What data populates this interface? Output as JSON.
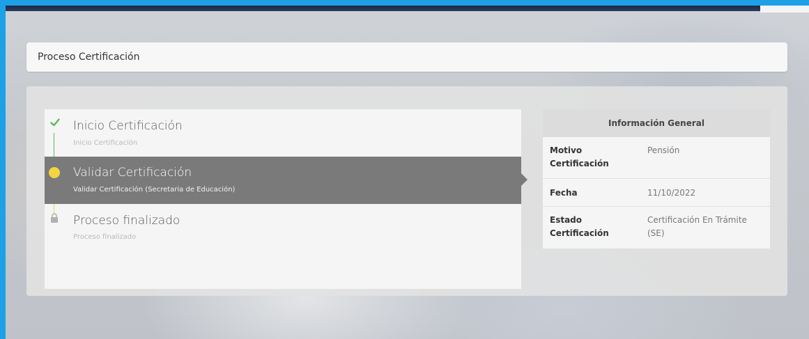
{
  "page": {
    "title": "Proceso Certificación"
  },
  "steps": [
    {
      "title": "Inicio Certificación",
      "subtitle": "Inicio Certificación",
      "status": "completed",
      "icon": "check-icon"
    },
    {
      "title": "Validar Certificación",
      "subtitle": "Validar Certificación (Secretaria de Educación)",
      "status": "active",
      "icon": "dot-icon"
    },
    {
      "title": "Proceso finalizado",
      "subtitle": "Proceso finalizado",
      "status": "locked",
      "icon": "lock-icon"
    }
  ],
  "info": {
    "header": "Información General",
    "rows": [
      {
        "label": "Motivo Certificación",
        "value": "Pensión"
      },
      {
        "label": "Fecha",
        "value": "11/10/2022"
      },
      {
        "label": "Estado Certificación",
        "value": "Certificación En Trámite (SE)"
      }
    ]
  },
  "colors": {
    "frame": "#1ea0e6",
    "completed": "#5cb85c",
    "active": "#f4d443",
    "active_bg": "#7a7a7a",
    "locked": "#b0b0b0"
  }
}
